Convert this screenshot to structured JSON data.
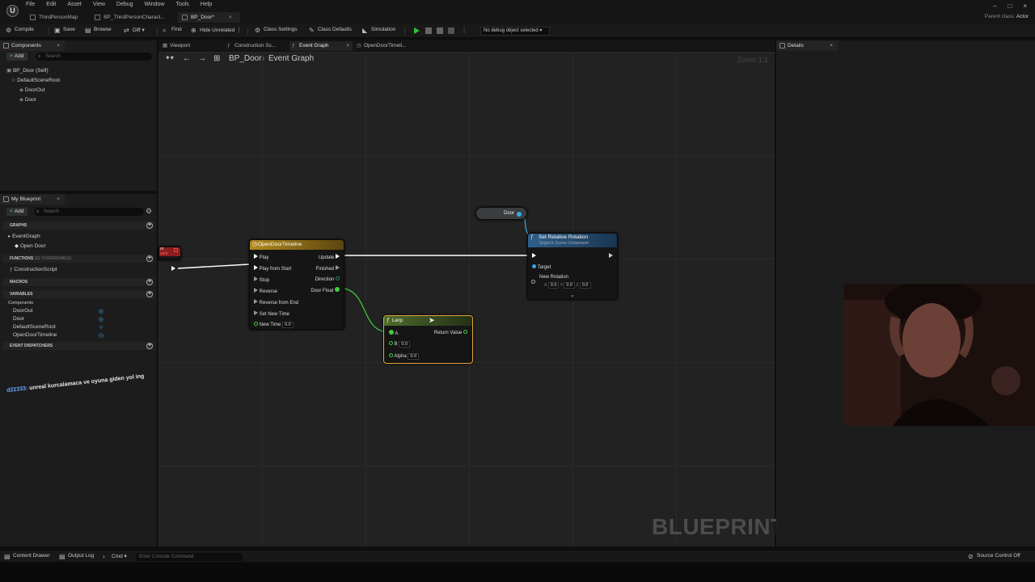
{
  "menu": [
    "File",
    "Edit",
    "Asset",
    "View",
    "Debug",
    "Window",
    "Tools",
    "Help"
  ],
  "tabs": [
    {
      "label": "ThirdPersonMap"
    },
    {
      "label": "BP_ThirdPersonCharact..."
    },
    {
      "label": "BP_Door*",
      "close": "×"
    }
  ],
  "window_controls": [
    "–",
    "□",
    "×"
  ],
  "parent_class": {
    "label": "Parent class:",
    "value": "Actor"
  },
  "toolbar": {
    "compile": "Compile",
    "save": "Save",
    "browse": "Browse",
    "diff": "Diff",
    "find": "Find",
    "hide_unrelated": "Hide Unrelated",
    "class_settings": "Class Settings",
    "class_defaults": "Class Defaults",
    "simulation": "Simulation",
    "debug_object": "No debug object selected"
  },
  "components_panel": {
    "title": "Components",
    "add": "Add",
    "search_placeholder": "Search",
    "tree": [
      "BP_Door (Self)",
      "DefaultSceneRoot",
      "DoorOut",
      "Door"
    ]
  },
  "my_blueprint": {
    "title": "My Blueprint",
    "add": "Add",
    "search_placeholder": "Search",
    "graphs_header": "GRAPHS",
    "event_graph": "EventGraph",
    "open_door": "Open Door",
    "functions_header": "FUNCTIONS",
    "functions_overridable": "(21 OVERRIDABLE)",
    "construction_script": "ConstructionScript",
    "macros_header": "MACROS",
    "variables_header": "VARIABLES",
    "components_group": "Components",
    "variables": [
      "DoorOut",
      "Door",
      "DefaultSceneRoot",
      "OpenDoorTimeline"
    ],
    "event_dispatchers_header": "EVENT DISPATCHERS"
  },
  "chat_message": {
    "user": "d22333:",
    "text": "unreal kurcalamaca ve oyuna giden yol ing"
  },
  "graph_tabs": [
    "Viewport",
    "Construction Sc...",
    "Event Graph",
    "OpenDoorTimeli..."
  ],
  "breadcrumb": {
    "blueprint": "BP_Door",
    "graph": "Event Graph"
  },
  "zoom": "Zoom 1:1",
  "watermark": "BLUEPRINT",
  "nodes": {
    "door_var": {
      "label": "Door"
    },
    "timeline": {
      "title": "OpenDoorTimeline",
      "inputs": [
        "Play",
        "Play from Start",
        "Stop",
        "Reverse",
        "Reverse from End",
        "Set New Time"
      ],
      "new_time_label": "New Time",
      "new_time_value": "0.0",
      "outputs": [
        "Update",
        "Finished",
        "Direction",
        "Door Float"
      ]
    },
    "set_rotation": {
      "title": "Set Relative Rotation",
      "subtitle": "Target is Scene Component",
      "target": "Target",
      "new_rotation": "New Rotation",
      "x_label": "X",
      "x": "0.0",
      "y_label": "Y",
      "y": "0.0",
      "z_label": "Z",
      "z": "0.0"
    },
    "lerp": {
      "title": "Lerp",
      "a": "A",
      "b": "B",
      "b_value": "0.0",
      "alpha": "Alpha",
      "alpha_value": "0.0",
      "return_value": "Return Value"
    },
    "partial_event": {
      "line1": "or",
      "line2": "vent"
    }
  },
  "details_panel": {
    "title": "Details"
  },
  "bottom_bar": {
    "content_drawer": "Content Drawer",
    "output_log": "Output Log",
    "cmd": "Cmd",
    "console_placeholder": "Enter Console Command",
    "source_control": "Source Control Off"
  },
  "colors": {
    "timeline_header": "#b38a1e",
    "function_header": "#2f5f8a",
    "lerp_header": "#4e6b2a",
    "float_pin": "#3fcf3f",
    "object_pin": "#3aa8e6",
    "exec_wire": "#ffffff"
  }
}
